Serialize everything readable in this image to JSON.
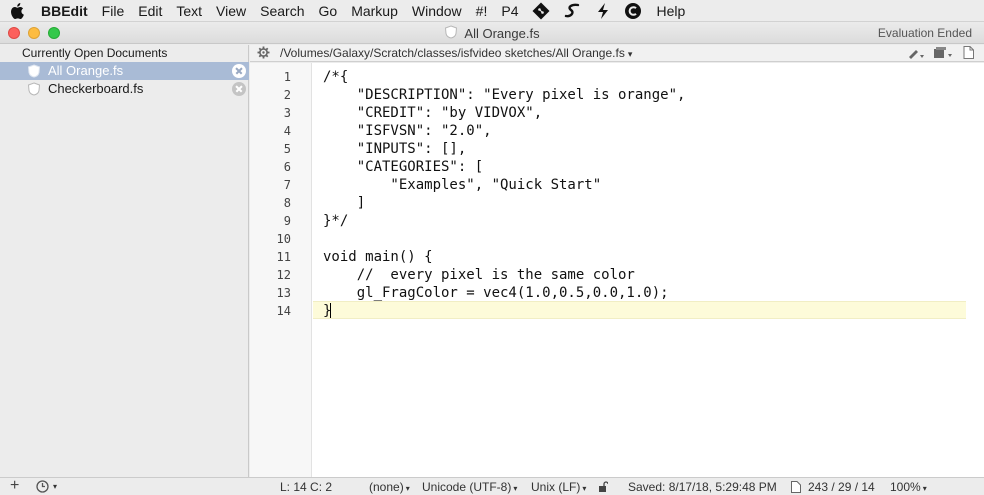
{
  "menubar": {
    "app_name": "BBEdit",
    "items": [
      "File",
      "Edit",
      "Text",
      "View",
      "Search",
      "Go",
      "Markup",
      "Window",
      "#!",
      "P4"
    ],
    "help": "Help"
  },
  "window": {
    "title": "All Orange.fs",
    "license_status": "Evaluation Ended"
  },
  "sidebar": {
    "header": "Currently Open Documents",
    "documents": [
      {
        "name": "All Orange.fs",
        "selected": true
      },
      {
        "name": "Checkerboard.fs",
        "selected": false
      }
    ]
  },
  "pathbar": {
    "path": "/Volumes/Galaxy/Scratch/classes/isfvideo sketches/All Orange.fs"
  },
  "editor": {
    "line_numbers": [
      "1",
      "2",
      "3",
      "4",
      "5",
      "6",
      "7",
      "8",
      "9",
      "10",
      "11",
      "12",
      "13",
      "14"
    ],
    "lines": [
      "/*{",
      "    \"DESCRIPTION\": \"Every pixel is orange\",",
      "    \"CREDIT\": \"by VIDVOX\",",
      "    \"ISFVSN\": \"2.0\",",
      "    \"INPUTS\": [],",
      "    \"CATEGORIES\": [",
      "        \"Examples\", \"Quick Start\"",
      "    ]",
      "}*/",
      "",
      "void main() {",
      "    //  every pixel is the same color",
      "    gl_FragColor = vec4(1.0,0.5,0.0,1.0);",
      "}"
    ],
    "current_line_color": "#fdfbd9"
  },
  "statusbar": {
    "position": "L: 14 C: 2",
    "language": "(none)",
    "encoding": "Unicode (UTF-8)",
    "line_endings": "Unix (LF)",
    "saved": "Saved: 8/17/18, 5:29:48 PM",
    "counts": "243 / 29 / 14",
    "zoom": "100%"
  },
  "colors": {
    "selection": "#a9bbd6",
    "close": "#fc605c",
    "minimize": "#fdbc40",
    "maximize": "#34c84a"
  }
}
